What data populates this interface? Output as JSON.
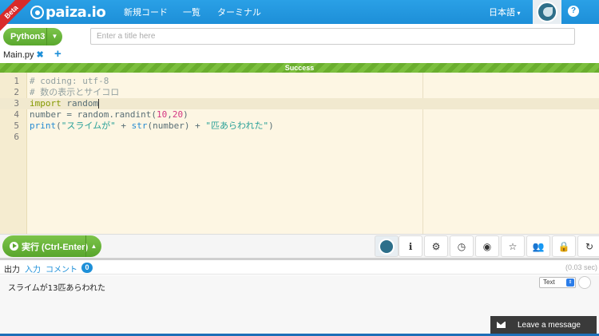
{
  "header": {
    "beta": "Beta",
    "logo_text": "paiza.io",
    "nav": [
      "新規コード",
      "一覧",
      "ターミナル"
    ],
    "language": "日本語",
    "help_label": "?"
  },
  "toolbar": {
    "language_button": "Python3",
    "title_placeholder": "Enter a title here"
  },
  "tabs": {
    "file_name": "Main.py",
    "close_label": "✖",
    "add_label": "+"
  },
  "status": {
    "label": "Success"
  },
  "editor": {
    "lines": [
      {
        "num": "1",
        "tokens": [
          {
            "t": "# coding: utf-8",
            "c": "cm"
          }
        ]
      },
      {
        "num": "2",
        "tokens": [
          {
            "t": "# 数の表示とサイコロ",
            "c": "cm"
          }
        ]
      },
      {
        "num": "3",
        "tokens": [
          {
            "t": "import",
            "c": "kw"
          },
          {
            "t": " random",
            "c": ""
          }
        ]
      },
      {
        "num": "4",
        "tokens": [
          {
            "t": "number = random.randint(",
            "c": ""
          },
          {
            "t": "10",
            "c": "nm"
          },
          {
            "t": ",",
            "c": ""
          },
          {
            "t": "20",
            "c": "nm"
          },
          {
            "t": ")",
            "c": ""
          }
        ]
      },
      {
        "num": "5",
        "tokens": [
          {
            "t": "print",
            "c": "fn"
          },
          {
            "t": "(",
            "c": ""
          },
          {
            "t": "\"スライムが\"",
            "c": "st"
          },
          {
            "t": " + ",
            "c": ""
          },
          {
            "t": "str",
            "c": "fn"
          },
          {
            "t": "(number) + ",
            "c": ""
          },
          {
            "t": "\"匹あらわれた\"",
            "c": "st"
          },
          {
            "t": ")",
            "c": ""
          }
        ]
      },
      {
        "num": "6",
        "tokens": []
      }
    ],
    "active_line": 3
  },
  "runbar": {
    "run_label": "実行 (Ctrl-Enter)",
    "tools": [
      {
        "name": "info-icon",
        "glyph": "ℹ"
      },
      {
        "name": "gear-icon",
        "glyph": "⚙"
      },
      {
        "name": "clock-icon",
        "glyph": "◷"
      },
      {
        "name": "github-icon",
        "glyph": "◉"
      },
      {
        "name": "star-icon",
        "glyph": "☆"
      },
      {
        "name": "users-icon",
        "glyph": "👥"
      },
      {
        "name": "lock-icon",
        "glyph": "🔒"
      },
      {
        "name": "share-icon",
        "glyph": "↻"
      }
    ]
  },
  "output": {
    "tab_output": "出力",
    "tab_input": "入力",
    "tab_comment": "コメント",
    "comment_count": "0",
    "elapsed": "(0.03 sec)",
    "text": "スライムが13匹あらわれた",
    "format": "Text"
  },
  "chat": {
    "label": "Leave a message"
  },
  "colors": {
    "header_blue": "#1d8fd8",
    "run_green": "#5aa82e",
    "editor_bg": "#fdf6e3"
  }
}
